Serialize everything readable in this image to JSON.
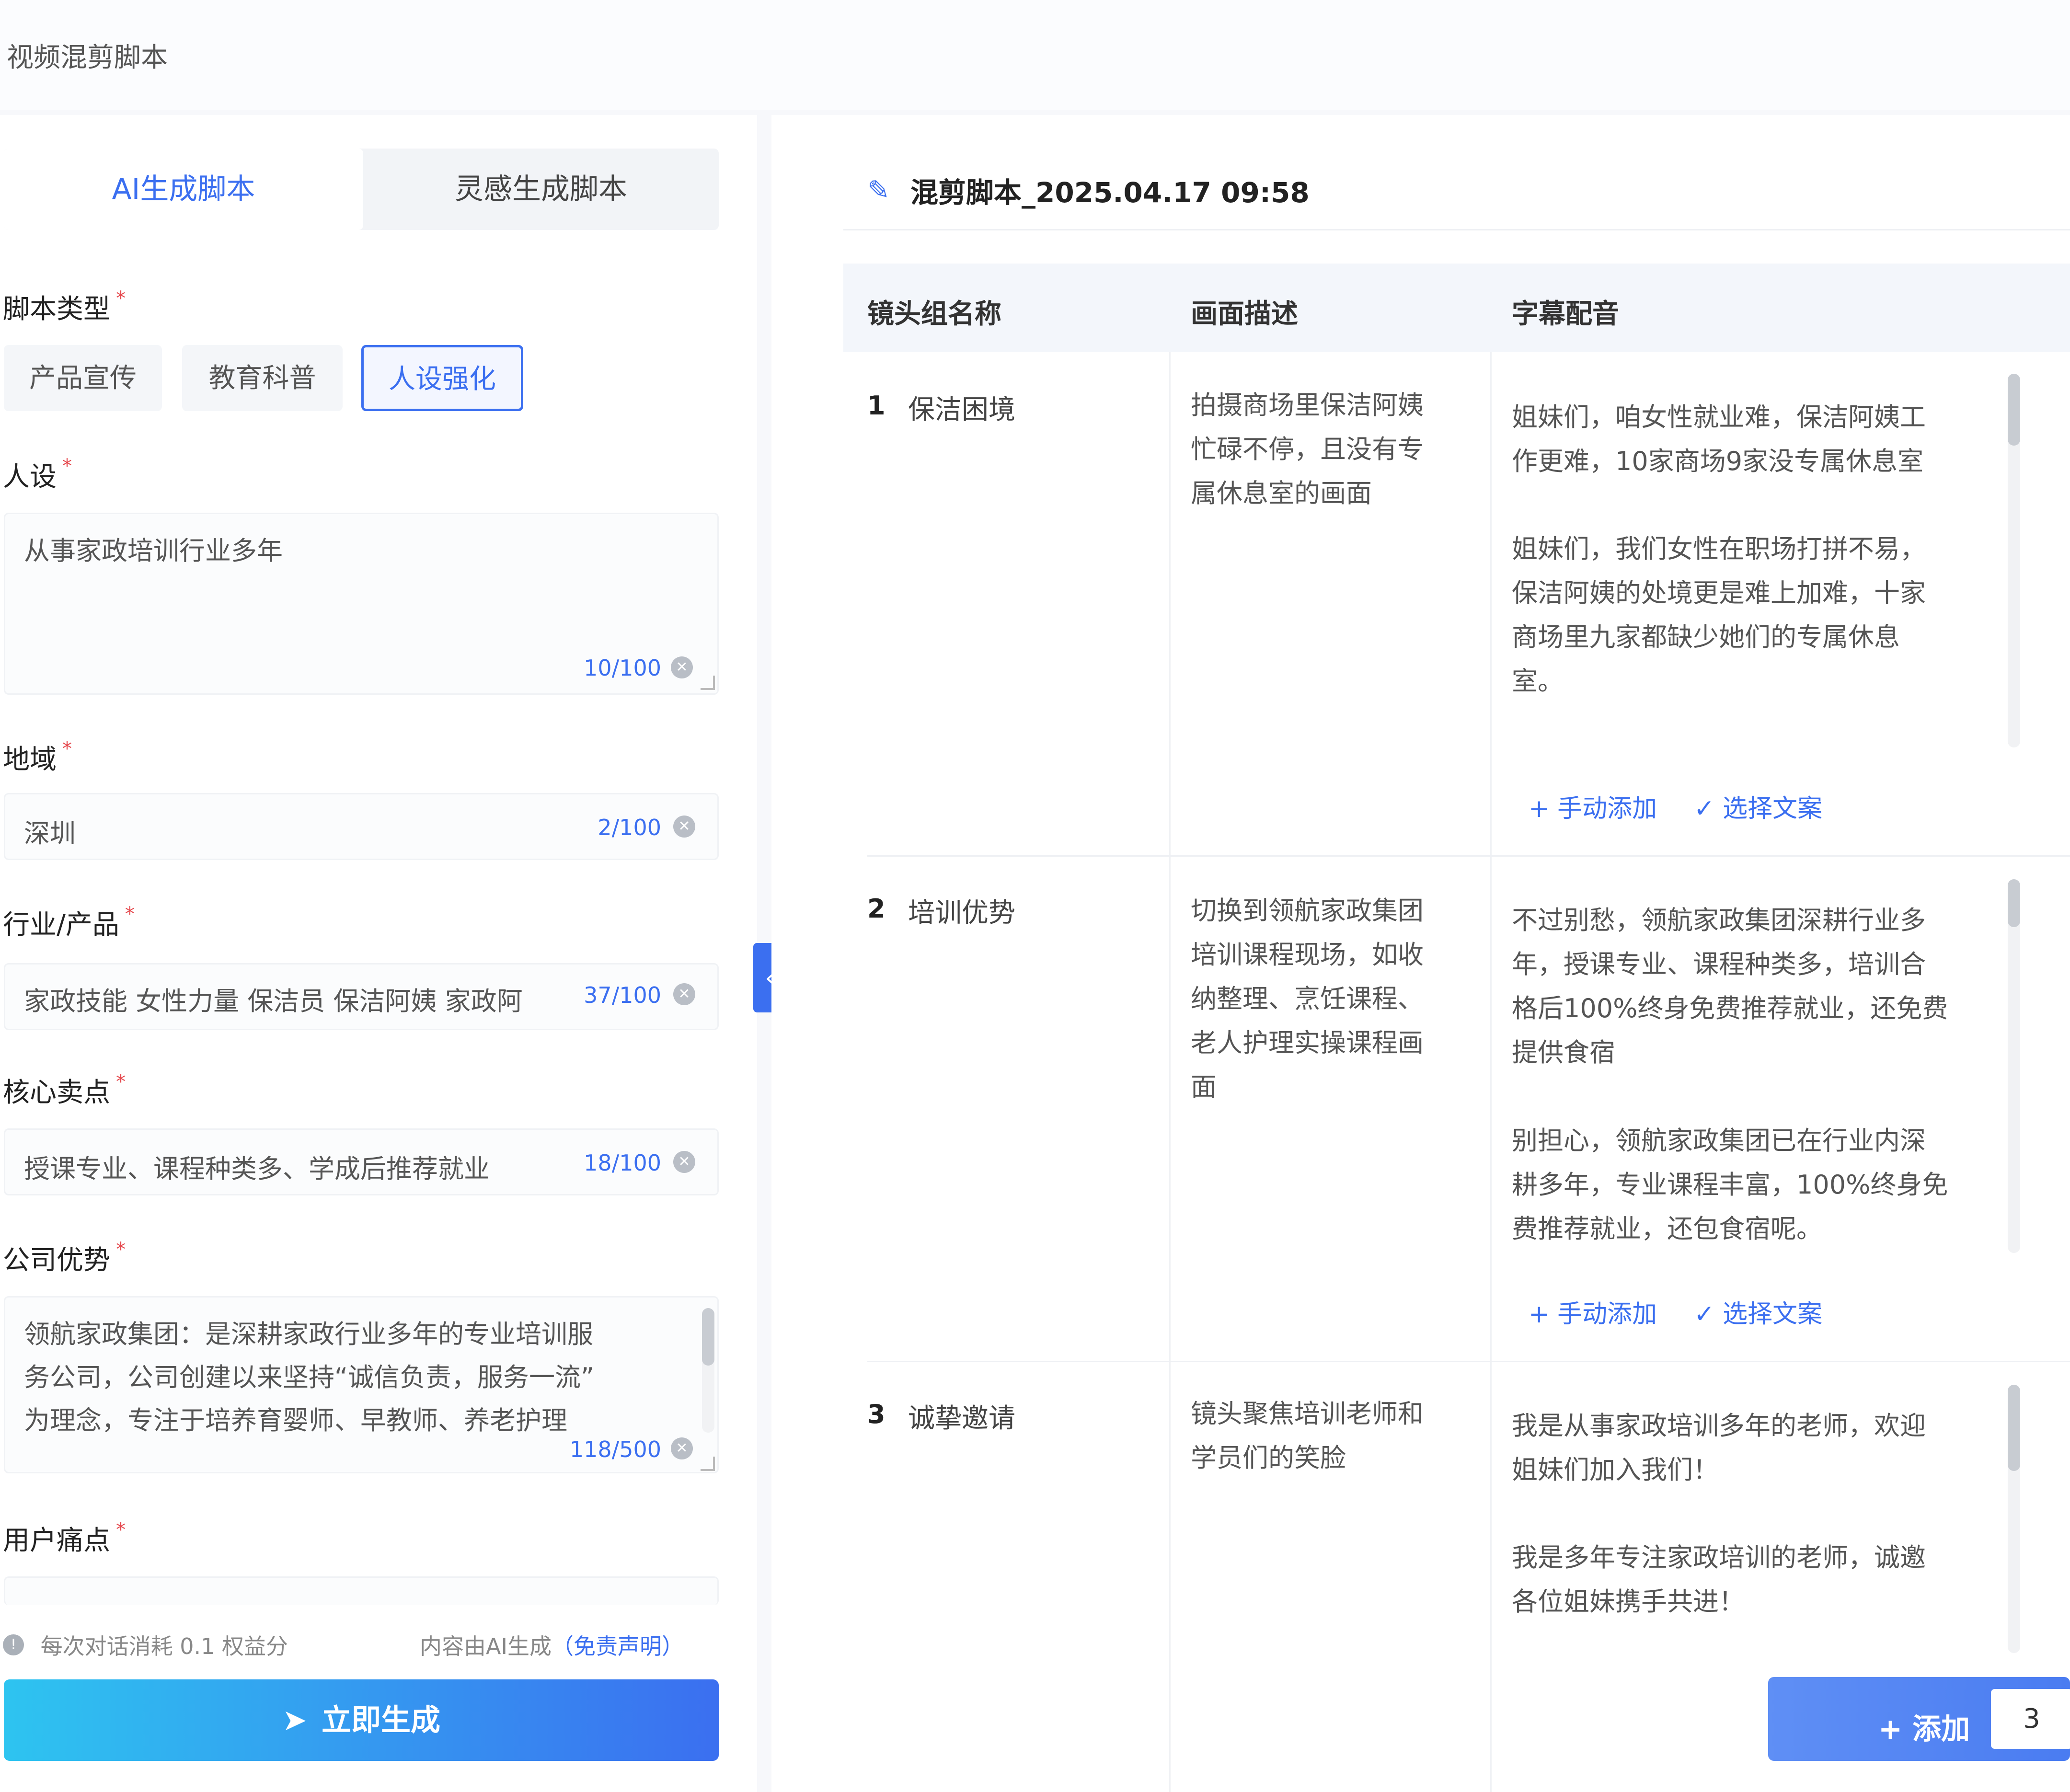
{
  "app": {
    "title": "视频混剪脚本"
  },
  "left": {
    "tabs": [
      {
        "label": "AI生成脚本"
      },
      {
        "label": "灵感生成脚本"
      }
    ],
    "script_type": {
      "label": "脚本类型",
      "options": [
        {
          "label": "产品宣传"
        },
        {
          "label": "教育科普"
        },
        {
          "label": "人设强化"
        }
      ],
      "selected": "人设强化"
    },
    "persona": {
      "label": "人设",
      "value": "从事家政培训行业多年",
      "counter": "10/100"
    },
    "region": {
      "label": "地域",
      "value": "深圳",
      "counter": "2/100"
    },
    "industry": {
      "label": "行业/产品",
      "value": "家政技能 女性力量 保洁员 保洁阿姨 家政阿",
      "counter": "37/100"
    },
    "selling_points": {
      "label": "核心卖点",
      "value": "授课专业、课程种类多、学成后推荐就业",
      "counter": "18/100"
    },
    "company": {
      "label": "公司优势",
      "lines": [
        "领航家政集团：是深耕家政行业多年的专业培训服",
        "务公司，公司创建以来坚持“诚信负责，服务一流”",
        "为理念，专注于培养育婴师、早教师、养老护理"
      ],
      "counter": "118/500"
    },
    "pain_points": {
      "label": "用户痛点"
    },
    "notice": {
      "cost": "每次对话消耗 0.1 权益分",
      "ai_note": "内容由AI生成",
      "disclaimer": "（免责声明）"
    },
    "generate_button": "立即生成"
  },
  "right": {
    "title": "混剪脚本_2025.04.17 09:58",
    "columns": [
      "镜头组名称",
      "画面描述",
      "字幕配音"
    ],
    "rows": [
      {
        "index": "1",
        "name": "保洁困境",
        "desc": [
          "拍摄商场里保洁阿姨",
          "忙碌不停，且没有专",
          "属休息室的画面"
        ],
        "subtitles": [
          [
            "姐妹们，咱女性就业难，保洁阿姨工",
            "作更难，10家商场9家没专属休息室"
          ],
          [
            "姐妹们，我们女性在职场打拼不易，",
            "保洁阿姨的处境更是难上加难，十家",
            "商场里九家都缺少她们的专属休息",
            "室。"
          ]
        ],
        "add_label": "+ 手动添加",
        "pick_label": "✓ 选择文案"
      },
      {
        "index": "2",
        "name": "培训优势",
        "desc": [
          "切换到领航家政集团",
          "培训课程现场，如收",
          "纳整理、烹饪课程、",
          "老人护理实操课程画",
          "面"
        ],
        "subtitles": [
          [
            "不过别愁，领航家政集团深耕行业多",
            "年，授课专业、课程种类多，培训合",
            "格后100%终身免费推荐就业，还免费",
            "提供食宿"
          ],
          [
            "别担心，领航家政集团已在行业内深",
            "耕多年，专业课程丰富，100%终身免",
            "费推荐就业，还包食宿呢。"
          ]
        ],
        "add_label": "+ 手动添加",
        "pick_label": "✓ 选择文案"
      },
      {
        "index": "3",
        "name": "诚挚邀请",
        "desc": [
          "镜头聚焦培训老师和",
          "学员们的笑脸"
        ],
        "subtitles": [
          [
            "我是从事家政培训多年的老师，欢迎",
            "姐妹们加入我们！"
          ],
          [
            "我是多年专注家政培训的老师，诚邀",
            "各位姐妹携手共进！"
          ]
        ]
      }
    ],
    "add_button": {
      "label": "+ 添加",
      "count": "3"
    }
  },
  "colors": {
    "accent": "#3b6ff0",
    "required": "#e5484d",
    "gradient_start": "#2ec4f0"
  }
}
